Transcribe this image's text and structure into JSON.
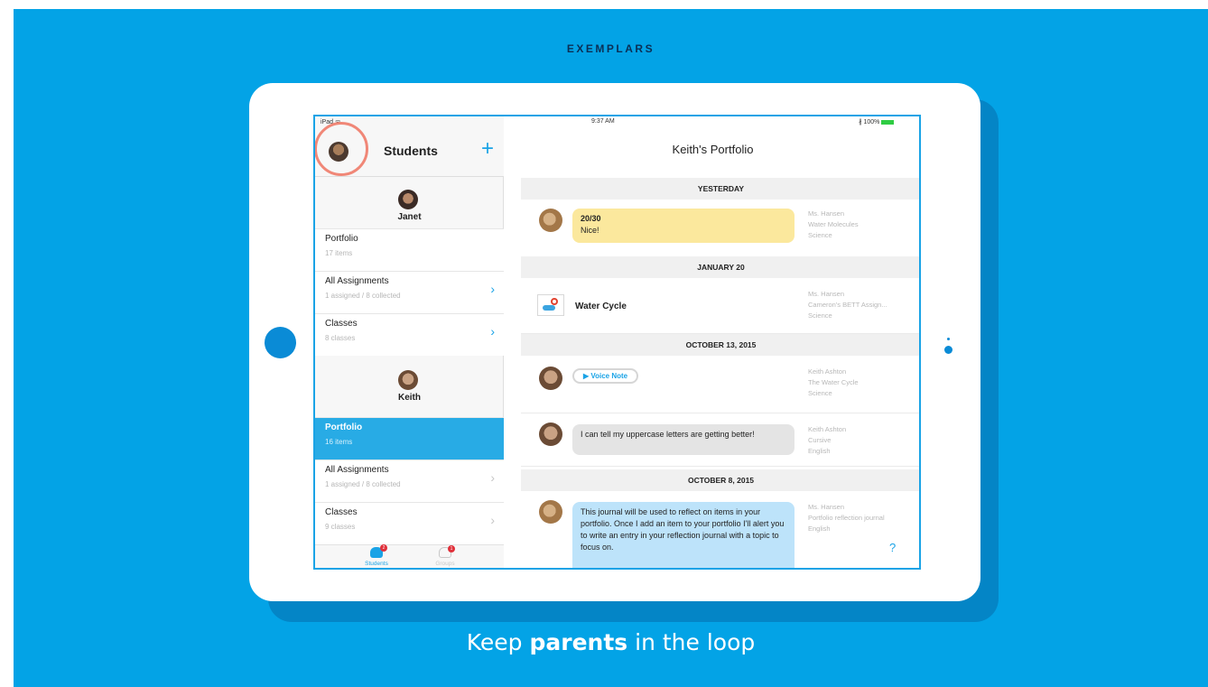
{
  "header": "EXEMPLARS",
  "tagline": {
    "pre": "Keep ",
    "bold": "parents",
    "post": " in the loop"
  },
  "status": {
    "device": "iPad ᯤ",
    "time": "9:37 AM",
    "battery": "∦ 100%"
  },
  "left_panel": {
    "title": "Students",
    "add_label": "+",
    "students": [
      {
        "name": "Janet",
        "rows": [
          {
            "title": "Portfolio",
            "sub": "17 items",
            "chevron": ""
          },
          {
            "title": "All Assignments",
            "sub": "1 assigned / 8 collected",
            "chevron": "›"
          },
          {
            "title": "Classes",
            "sub": "8 classes",
            "chevron": "›"
          }
        ]
      },
      {
        "name": "Keith",
        "rows": [
          {
            "title": "Portfolio",
            "sub": "16 items",
            "chevron": ""
          },
          {
            "title": "All Assignments",
            "sub": "1 assigned / 8 collected",
            "chevron": "›"
          },
          {
            "title": "Classes",
            "sub": "9 classes",
            "chevron": "›"
          }
        ]
      }
    ],
    "tabs": [
      {
        "label": "Students",
        "badge": "2",
        "color": "#1aa3e6"
      },
      {
        "label": "Groups",
        "badge": "1",
        "color": "#c8c8c8"
      }
    ]
  },
  "right_panel": {
    "title": "Keith's Portfolio",
    "sections": [
      "YESTERDAY",
      "JANUARY 20",
      "OCTOBER 13, 2015",
      "OCTOBER 8, 2015"
    ],
    "items": [
      {
        "bubble_title": "20/30",
        "bubble_text": "Nice!",
        "meta": [
          "Ms. Hansen",
          "Water Molecules",
          "Science"
        ]
      },
      {
        "title": "Water Cycle",
        "meta": [
          "Ms. Hansen",
          "Cameron's BETT Assign...",
          "Science"
        ]
      },
      {
        "voice": "▶ Voice Note",
        "meta": [
          "Keith Ashton",
          "The Water Cycle",
          "Science"
        ]
      },
      {
        "bubble_text": "I can tell my uppercase letters are getting better!",
        "meta": [
          "Keith Ashton",
          "Cursive",
          "English"
        ]
      },
      {
        "bubble_text": "This journal will be used to reflect on items in your portfolio. Once I add an item to your portfolio I'll alert you to write an entry in your reflection journal with a topic to focus on.",
        "meta": [
          "Ms. Hansen",
          "Portfolio reflection journal",
          "English"
        ]
      }
    ],
    "help": "?"
  },
  "colors": {
    "background": "#03a3e6",
    "accent": "#1aa3e6",
    "highlight": "#f08777"
  }
}
